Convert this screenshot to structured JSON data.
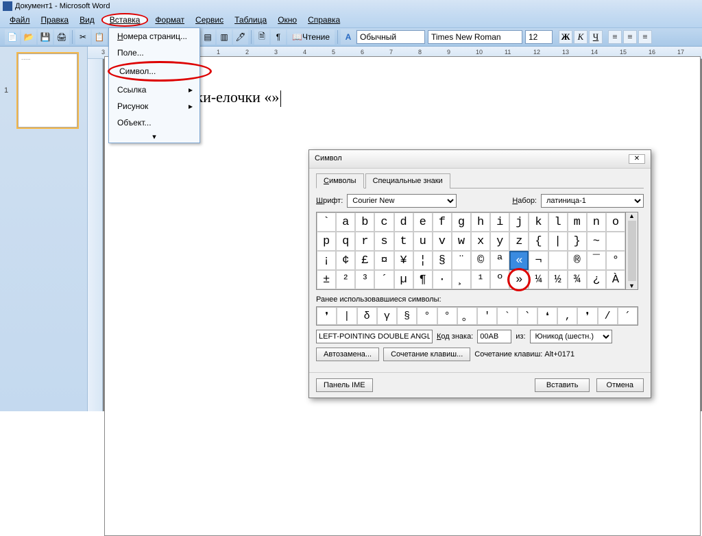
{
  "title": "Документ1 - Microsoft Word",
  "menu": {
    "file": "Файл",
    "edit": "Правка",
    "view": "Вид",
    "insert": "Вставка",
    "format": "Формат",
    "tools": "Сервис",
    "table": "Таблица",
    "window": "Окно",
    "help": "Справка"
  },
  "insert_menu": {
    "page_numbers": "Номера страниц...",
    "field": "Поле...",
    "symbol": "Символ...",
    "reference": "Ссылка",
    "picture": "Рисунок",
    "object": "Объект..."
  },
  "toolbar": {
    "reading": "Чтение",
    "style": "Обычный",
    "font": "Times New Roman",
    "size": "12",
    "bold": "Ж",
    "italic": "К",
    "underline": "Ч"
  },
  "ruler_ticks": [
    "3",
    "2",
    "1",
    "",
    "1",
    "2",
    "3",
    "4",
    "5",
    "6",
    "7",
    "8",
    "9",
    "10",
    "11",
    "12",
    "13",
    "14",
    "15",
    "16",
    "17"
  ],
  "page_number": "1",
  "document_text": "Кавычки-елочки «»",
  "thumb_text": "........",
  "dialog": {
    "title": "Символ",
    "tab_symbols": "Символы",
    "tab_special": "Специальные знаки",
    "font_label": "Шрифт:",
    "font_value": "Courier New",
    "set_label": "Набор:",
    "set_value": "латиница-1",
    "grid": [
      "`",
      "a",
      "b",
      "c",
      "d",
      "e",
      "f",
      "g",
      "h",
      "i",
      "j",
      "k",
      "l",
      "m",
      "n",
      "o",
      "p",
      "q",
      "r",
      "s",
      "t",
      "u",
      "v",
      "w",
      "x",
      "y",
      "z",
      "{",
      "|",
      "}",
      "~",
      "",
      "¡",
      "¢",
      "£",
      "¤",
      "¥",
      "¦",
      "§",
      "¨",
      "©",
      "ª",
      "«",
      "¬",
      "­",
      "®",
      "¯",
      "°",
      "±",
      "²",
      "³",
      "´",
      "µ",
      "¶",
      "·",
      "¸",
      "¹",
      "º",
      "»",
      "¼",
      "½",
      "¾",
      "¿",
      "À"
    ],
    "selected_index": 42,
    "ringed_index": 58,
    "recent_label": "Ранее использовавшиеся символы:",
    "recent": [
      "❜",
      "|",
      "δ",
      "γ",
      "§",
      "°",
      "°",
      "。",
      "'",
      "`",
      "՝",
      "❛",
      "‚",
      "❜",
      "/",
      "՛"
    ],
    "desc": "LEFT-POINTING DOUBLE ANGLE QU…",
    "code_label": "Код знака:",
    "code_value": "00AB",
    "from_label": "из:",
    "from_value": "Юникод (шестн.)",
    "autocorrect": "Автозамена...",
    "shortcut_btn": "Сочетание клавиш...",
    "shortcut_label": "Сочетание клавиш: Alt+0171",
    "ime_panel": "Панель IME",
    "insert": "Вставить",
    "cancel": "Отмена"
  }
}
